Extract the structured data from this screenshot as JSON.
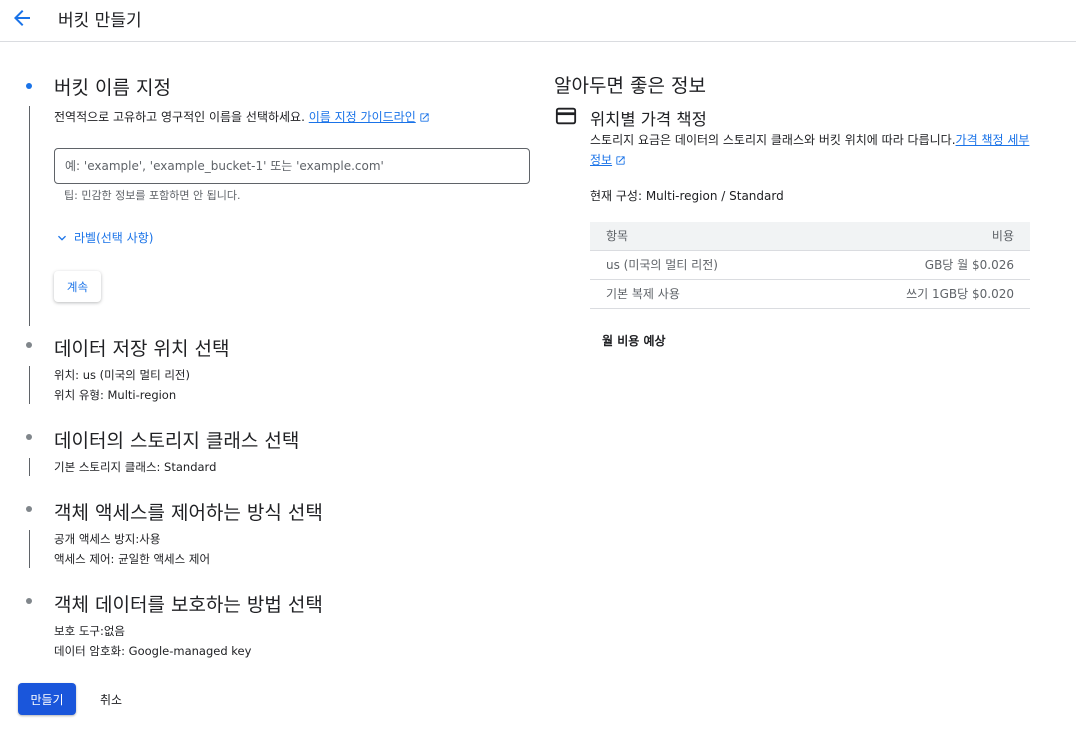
{
  "header": {
    "title": "버킷 만들기"
  },
  "steps": [
    {
      "title": "버킷 이름 지정",
      "description": "전역적으로 고유하고 영구적인 이름을 선택하세요.",
      "guide_link": "이름 지정 가이드라인",
      "input_placeholder": "예: 'example', 'example_bucket-1' 또는 'example.com'",
      "hint": "팁: 민감한 정보를 포함하면 안 됩니다.",
      "labels_toggle": "라벨(선택 사항)",
      "continue_label": "계속"
    },
    {
      "title": "데이터 저장 위치 선택",
      "lines": [
        "위치: us (미국의 멀티 리전)",
        "위치 유형: Multi-region"
      ]
    },
    {
      "title": "데이터의 스토리지 클래스 선택",
      "lines": [
        "기본 스토리지 클래스: Standard"
      ]
    },
    {
      "title": "객체 액세스를 제어하는 방식 선택",
      "lines": [
        "공개 액세스 방지:사용",
        "액세스 제어: 균일한 액세스 제어"
      ]
    },
    {
      "title": "객체 데이터를 보호하는 방법 선택",
      "lines": [
        "보호 도구:없음",
        "데이터 암호화: Google-managed key"
      ]
    }
  ],
  "actions": {
    "create_label": "만들기",
    "cancel_label": "취소"
  },
  "info": {
    "title": "알아두면 좋은 정보",
    "pricing_title": "위치별 가격 책정",
    "pricing_desc": "스토리지 요금은 데이터의 스토리지 클래스와 버킷 위치에 따라 다릅니다.",
    "pricing_link": "가격 책정 세부정보",
    "config": "현재 구성: Multi-region / Standard",
    "table": {
      "headers": [
        "항목",
        "비용"
      ],
      "rows": [
        [
          "us (미국의 멀티 리전)",
          "GB당 월 $0.026"
        ],
        [
          "기본 복제 사용",
          "쓰기 1GB당 $0.020"
        ]
      ]
    },
    "estimate": "월 비용 예상"
  },
  "colors": {
    "accent": "#1a73e8",
    "primary_button": "#1a56db"
  }
}
